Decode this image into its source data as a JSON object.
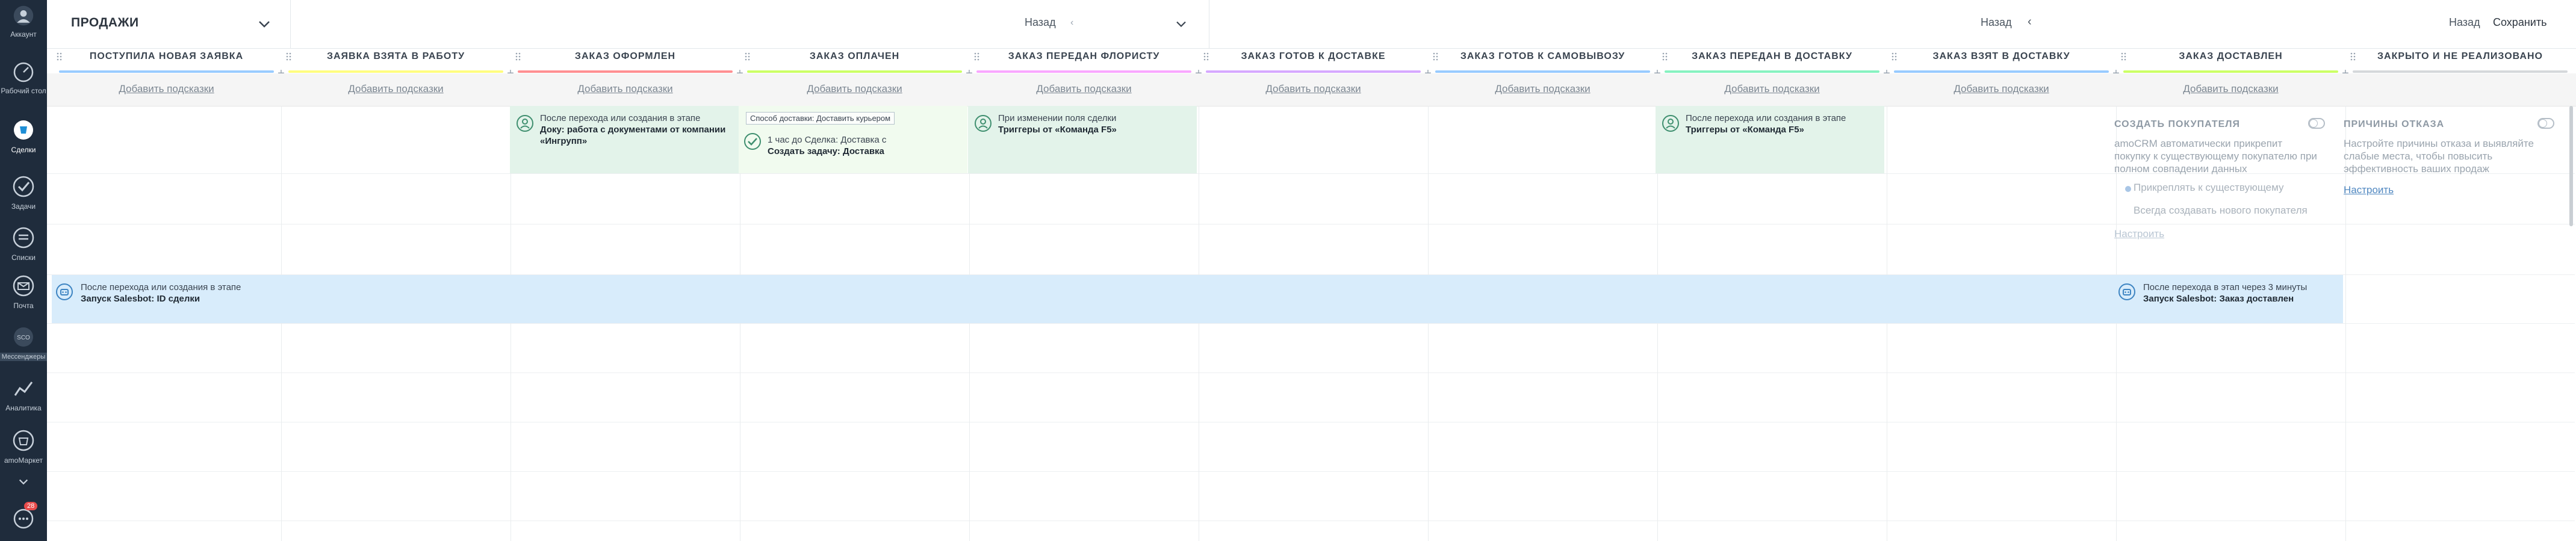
{
  "sidebar": {
    "items": [
      {
        "label": "Аккаунт",
        "icon": "account-avatar-icon"
      },
      {
        "label": "Рабочий стол",
        "icon": "dashboard-icon"
      },
      {
        "label": "Сделки",
        "icon": "deals-icon",
        "active": true
      },
      {
        "label": "Задачи",
        "icon": "tasks-check-icon"
      },
      {
        "label": "Списки",
        "icon": "lists-icon"
      },
      {
        "label": "Почта",
        "icon": "mail-icon"
      },
      {
        "label": "Мессенджеры",
        "icon": "chat-icon"
      },
      {
        "label": "Аналитика",
        "icon": "analytics-icon"
      },
      {
        "label": "amoМаркет",
        "icon": "market-icon"
      },
      {
        "label": "",
        "icon": "chevron-down-icon"
      },
      {
        "label": "",
        "icon": "notifications-icon",
        "badge": "28"
      }
    ],
    "messenger_avatar": "SCO"
  },
  "topbar": {
    "pipeline_name": "ПРОДАЖИ",
    "back_label_1": "Назад",
    "back_label_2": "Назад",
    "back_label_3": "Назад",
    "save_label": "Сохранить"
  },
  "stages": [
    {
      "title": "Поступила новая заявка",
      "color": "#99ccff"
    },
    {
      "title": "Заявка взята в работу",
      "color": "#fffd7f"
    },
    {
      "title": "Заказ оформлен",
      "color": "#ff8f92"
    },
    {
      "title": "Заказ оплачен",
      "color": "#ccff66"
    },
    {
      "title": "Заказ передан флористу",
      "color": "#f9a7ff"
    },
    {
      "title": "Заказ готов к доставке",
      "color": "#d6a8ff"
    },
    {
      "title": "Заказ готов к самовывозу",
      "color": "#98cbff"
    },
    {
      "title": "Заказ передан в доставку",
      "color": "#87f2c0"
    },
    {
      "title": "Заказ взят в доставку",
      "color": "#98cbff"
    },
    {
      "title": "Заказ доставлен",
      "color": "#ccff66"
    },
    {
      "title": "Закрыто и не реализовано",
      "color": "#d5d8db"
    }
  ],
  "hint_label": "Добавить подсказки",
  "cards": {
    "c3": {
      "line1": "После перехода или создания в этапе",
      "line2": "Доку: работа с документами от компании «Ингрупп»"
    },
    "c4": {
      "chip": "Способ доставки: Доставить курьером",
      "line1": "1 час до Сделка: Доставка с",
      "line2": "Создать задачу: Доставка"
    },
    "c5": {
      "line1": "При изменении поля сделки",
      "line2": "Триггеры от «Команда F5»"
    },
    "c8": {
      "line1": "После перехода или создания в этапе",
      "line2": "Триггеры от «Команда F5»"
    },
    "bot1": {
      "line1": "После перехода или создания в этапе",
      "line2": "Запуск Salesbot: ID сделки"
    },
    "bot2": {
      "line1": "После перехода в этап через 3 минуты",
      "line2": "Запуск Salesbot: Заказ доставлен"
    }
  },
  "panels": {
    "create_buyer": {
      "title": "СОЗДАТЬ ПОКУПАТЕЛЯ",
      "text": "amoCRM автоматически прикрепит покупку к существующему покупателю при полном совпадении данных",
      "option1": "Прикреплять к существующему",
      "option2": "Всегда создавать нового покупателя",
      "link": "Настроить"
    },
    "loss_reasons": {
      "title": "ПРИЧИНЫ ОТКАЗА",
      "text": "Настройте причины отказа и выявляйте слабые места, чтобы повысить эффективность ваших продаж",
      "link": "Настроить"
    }
  },
  "colors": {
    "sidebar": "#1f2c3c",
    "card_green": "#e3f3ea",
    "bot_blue": "#d8ecfb",
    "card_light_green": "#f1fbef"
  }
}
